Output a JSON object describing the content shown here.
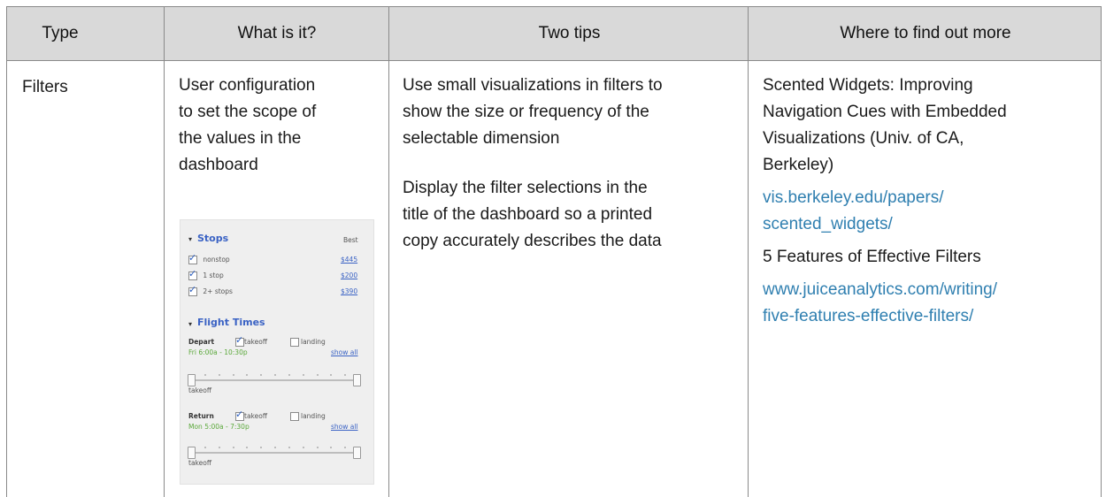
{
  "headers": [
    "Type",
    "What is it?",
    "Two tips",
    "Where to find out more"
  ],
  "row": {
    "type": "Filters",
    "what_lines": [
      "User configuration",
      "to set the scope of",
      "the values in the",
      "dashboard"
    ],
    "tips": [
      [
        "Use small visualizations in filters to",
        "show the size or frequency of the",
        "selectable dimension"
      ],
      [
        "Display the filter selections in the",
        "title of the dashboard so a printed",
        "copy accurately describes the data"
      ]
    ],
    "more": {
      "ref1_lines": [
        "Scented Widgets: Improving",
        "Navigation Cues with Embedded",
        "Visualizations (Univ. of CA,",
        "Berkeley)"
      ],
      "link1_lines": [
        "vis.berkeley.edu/papers/",
        "scented_widgets/"
      ],
      "ref2": "5 Features of Effective Filters",
      "link2_lines": [
        "www.juiceanalytics.com/writing/",
        "five-features-effective-filters/"
      ]
    }
  },
  "widget": {
    "stops_title": "Stops",
    "best_label": "Best",
    "stops": [
      {
        "label": "nonstop",
        "price": "$445",
        "checked": true
      },
      {
        "label": "1 stop",
        "price": "$200",
        "checked": true
      },
      {
        "label": "2+ stops",
        "price": "$390",
        "checked": true
      }
    ],
    "flight_times_title": "Flight Times",
    "depart_label": "Depart",
    "return_label": "Return",
    "takeoff_label": "takeoff",
    "landing_label": "landing",
    "depart_range": "Fri 6:00a - 10:30p",
    "return_range": "Mon 5:00a - 7:30p",
    "show_all": "show all",
    "slider_caption": "takeoff"
  },
  "colors": {
    "header_bg": "#d9d9d9",
    "link": "#2f7fb0",
    "widget_accent": "#3a62c4",
    "widget_green": "#5aa83a"
  }
}
